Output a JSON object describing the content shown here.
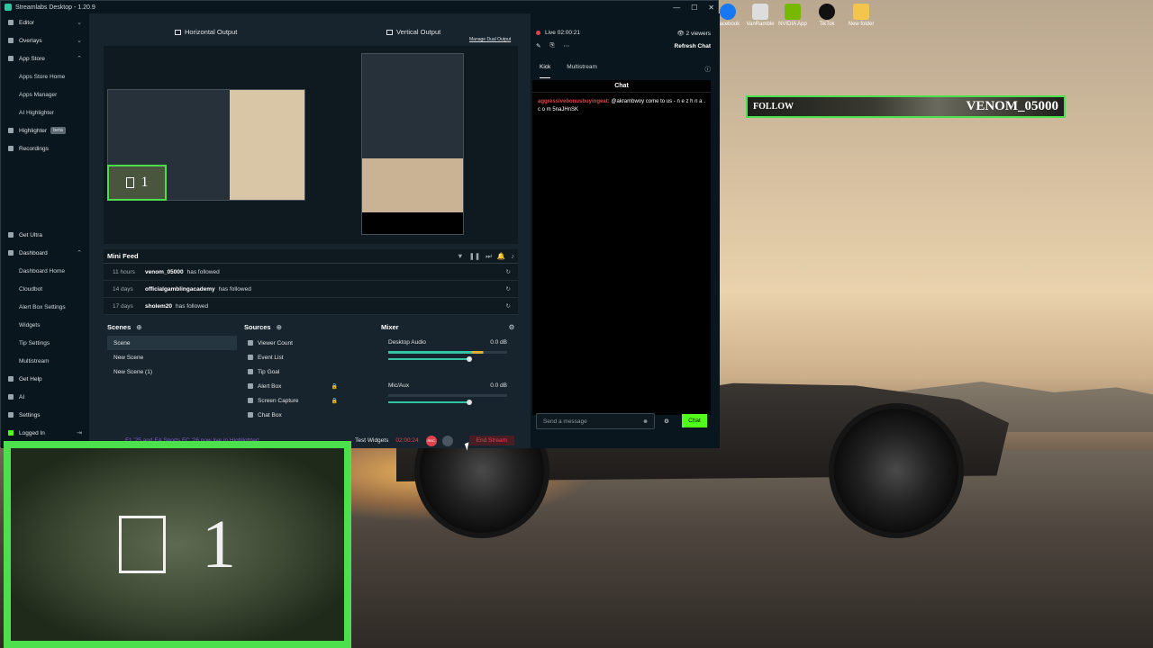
{
  "window": {
    "title": "Streamlabs Desktop - 1.20.9"
  },
  "sidebar": {
    "items": [
      {
        "label": "Editor",
        "icon": "editor-icon"
      },
      {
        "label": "Overlays",
        "icon": "overlays-icon"
      },
      {
        "label": "App Store",
        "icon": "store-icon"
      },
      {
        "label": "Apps Store Home",
        "sub": true
      },
      {
        "label": "Apps Manager",
        "sub": true
      },
      {
        "label": "AI Highlighter",
        "sub": true
      },
      {
        "label": "Highlighter",
        "badge": "beta",
        "icon": "highlighter-icon"
      },
      {
        "label": "Recordings",
        "icon": "recordings-icon"
      }
    ],
    "lower": [
      {
        "label": "Get Ultra"
      },
      {
        "label": "Dashboard"
      },
      {
        "label": "Dashboard Home"
      },
      {
        "label": "Cloudbot"
      },
      {
        "label": "Alert Box Settings"
      },
      {
        "label": "Widgets"
      },
      {
        "label": "Tip Settings"
      },
      {
        "label": "Multistream"
      },
      {
        "label": "Get Help"
      },
      {
        "label": "AI"
      },
      {
        "label": "Settings"
      },
      {
        "label": "Logged In"
      }
    ]
  },
  "outputs": {
    "horizontal": "Horizontal Output",
    "vertical": "Vertical Output",
    "manage": "Manage Dual Output"
  },
  "minifeed": {
    "title": "Mini Feed",
    "rows": [
      {
        "age": "11 hours",
        "user": "venom_05000",
        "action": "has followed"
      },
      {
        "age": "14 days",
        "user": "officialgamblingacademy",
        "action": "has followed"
      },
      {
        "age": "17 days",
        "user": "sholem20",
        "action": "has followed"
      }
    ]
  },
  "scenes": {
    "title": "Scenes",
    "items": [
      "Scene",
      "New Scene",
      "New Scene (1)"
    ]
  },
  "sources": {
    "title": "Sources",
    "items": [
      "Viewer Count",
      "Event List",
      "Tip Goal",
      "Alert Box",
      "Screen Capture",
      "Chat Box"
    ]
  },
  "mixer": {
    "title": "Mixer",
    "channels": [
      {
        "name": "Desktop Audio",
        "db": "0.0 dB"
      },
      {
        "name": "Mic/Aux",
        "db": "0.0 dB"
      }
    ]
  },
  "footer": {
    "notice": "F1 '25 and EA Sports FC '26 now live in Highlighter!",
    "test_widgets": "Test Widgets",
    "timer": "02:00:24",
    "rec": "REC",
    "end_stream": "End Stream"
  },
  "chat": {
    "live": "Live 02:00:21",
    "viewers": "2 viewers",
    "refresh": "Refresh Chat",
    "tabs": [
      "Kick",
      "Multistream"
    ],
    "title": "Chat",
    "message_user": "aggressivebonusbuyingeat:",
    "message_text": "@akrambwoy come to us - n e z h n a . c o m 5naJHnSK",
    "placeholder": "Send a message",
    "send": "Chat"
  },
  "desktop_icons": [
    "Facebook",
    "VanRamble",
    "NVIDIA App",
    "TikTok",
    "New folder"
  ],
  "follow_bar": {
    "label": "FOLLOW",
    "name": "VENOM_05000"
  },
  "cam_overlay": {
    "count": "1"
  }
}
